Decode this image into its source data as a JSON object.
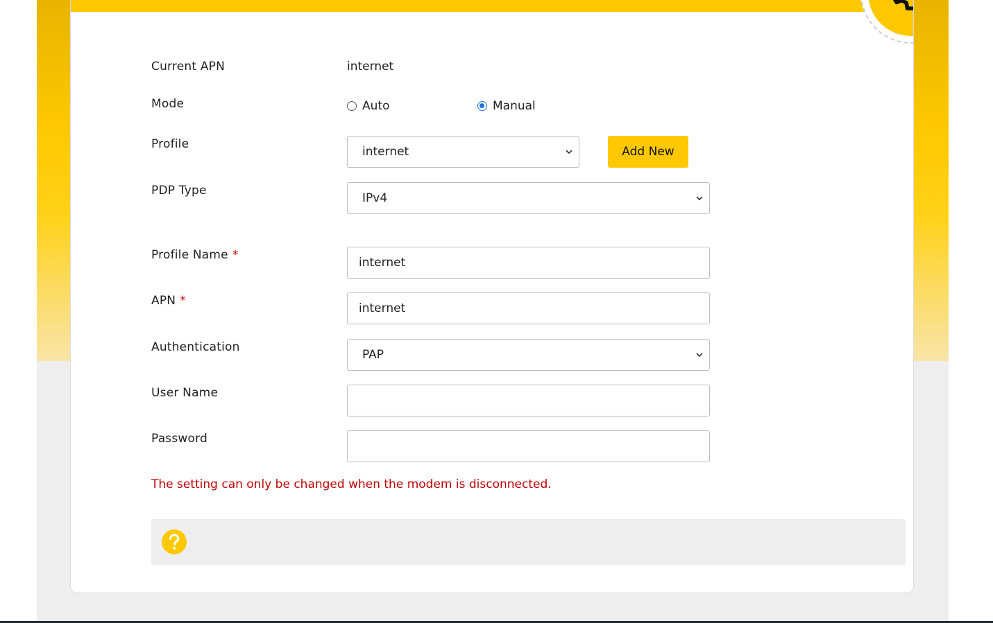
{
  "apn": {
    "current_label": "Current APN",
    "current_value": "internet",
    "mode_label": "Mode",
    "mode_options": [
      {
        "label": "Auto",
        "checked": false
      },
      {
        "label": "Manual",
        "checked": true
      }
    ],
    "profile_label": "Profile",
    "profile_value": "internet",
    "add_new_label": "Add New",
    "pdp_label": "PDP Type",
    "pdp_value": "IPv4",
    "profile_name_label": "Profile Name",
    "profile_name_value": "internet",
    "apn_label": "APN",
    "apn_value": "internet",
    "required_mark": "*",
    "auth_label": "Authentication",
    "auth_value": "PAP",
    "username_label": "User Name",
    "username_value": "",
    "password_label": "Password",
    "password_value": "",
    "warning": "The setting can only be changed when the modem is disconnected."
  },
  "colors": {
    "brand_yellow": "#fdc800",
    "warning_red": "#c00000",
    "radio_blue": "#1a73e8"
  },
  "icons": {
    "header": "gear-icon",
    "help": "question-icon"
  }
}
